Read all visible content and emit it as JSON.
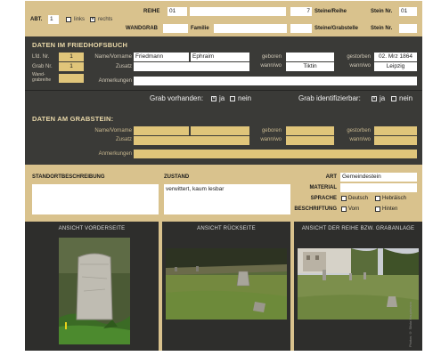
{
  "header": {
    "abt_label": "ABT.",
    "abt_value": "1",
    "links_label": "links",
    "rechts_label": "rechts",
    "rechts_checked": true,
    "links_checked": false,
    "reihe_label": "REIHE",
    "reihe_value": "01",
    "steine_reihe_value": "7",
    "steine_reihe_label": "Steine/Reihe",
    "stein_nr_label": "Stein Nr.",
    "stein_nr_value": "01",
    "wandgrab_label": "WANDGRAB",
    "familie_label": "Familie",
    "steine_grabstelle_label": "Steine/Grabstelle",
    "stein_nr2_label": "Stein Nr."
  },
  "friedhofsbuch": {
    "title": "DATEN IM FRIEDHOFSBUCH",
    "lfd_nr_label": "Lfd. Nr.",
    "lfd_nr_value": "1",
    "grab_nr_label": "Grab Nr.",
    "grab_nr_value": "1",
    "wand_label": "Wand-\ngrabreihe",
    "name_label": "Name/Vorname",
    "name_value": "Friedmann",
    "vorname_value": "Ephraim",
    "zusatz_label": "Zusatz",
    "anmerkungen_label": "Anmerkungen",
    "geboren_label": "geboren",
    "wann_wo_label": "wann/wo",
    "geboren_ort_value": "Tiktin",
    "gestorben_label": "gestorben",
    "gestorben_value": "02. Mrz 1864",
    "wann_wo2_label": "wann/wo",
    "gestorben_ort_value": "Leipzig",
    "grab_vorhanden_label": "Grab vorhanden:",
    "grab_identifizierbar_label": "Grab identifizierbar:",
    "ja_label": "ja",
    "nein_label": "nein",
    "grab_vorhanden_ja": true,
    "grab_identifizierbar_ja": true
  },
  "grabstein": {
    "title": "DATEN AM GRABSTEIN:",
    "name_label": "Name/Vorname",
    "zusatz_label": "Zusatz",
    "anmerkungen_label": "Anmerkungen",
    "geboren_label": "geboren",
    "wann_wo_label": "wann/wo",
    "gestorben_label": "gestorben",
    "wann_wo2_label": "wann/wo"
  },
  "standort": {
    "standort_label": "STANDORTBESCHREIBUNG",
    "zustand_label": "ZUSTAND",
    "zustand_value": "verwittert, kaum lesbar",
    "art_label": "ART",
    "art_value": "Gemeindestein",
    "material_label": "MATERIAL",
    "sprache_label": "SPRACHE",
    "deutsch_label": "Deutsch",
    "hebraeisch_label": "Hebräisch",
    "beschriftung_label": "BESCHRIFTUNG",
    "vorn_label": "Vorn",
    "hinten_label": "Hinten"
  },
  "photos": {
    "front_caption": "ANSICHT VORDERSEITE",
    "back_caption": "ANSICHT RÜCKSEITE",
    "row_caption": "ANSICHT DER REIHE BZW. GRABANLAGE",
    "credit": "Photos © Silvia Hauptmann"
  },
  "colors": {
    "card_bg": "#d9c28d",
    "dark_section": "#3a3a37",
    "gold_field": "#e0c57a",
    "photo_bg": "#2e2e2c"
  }
}
